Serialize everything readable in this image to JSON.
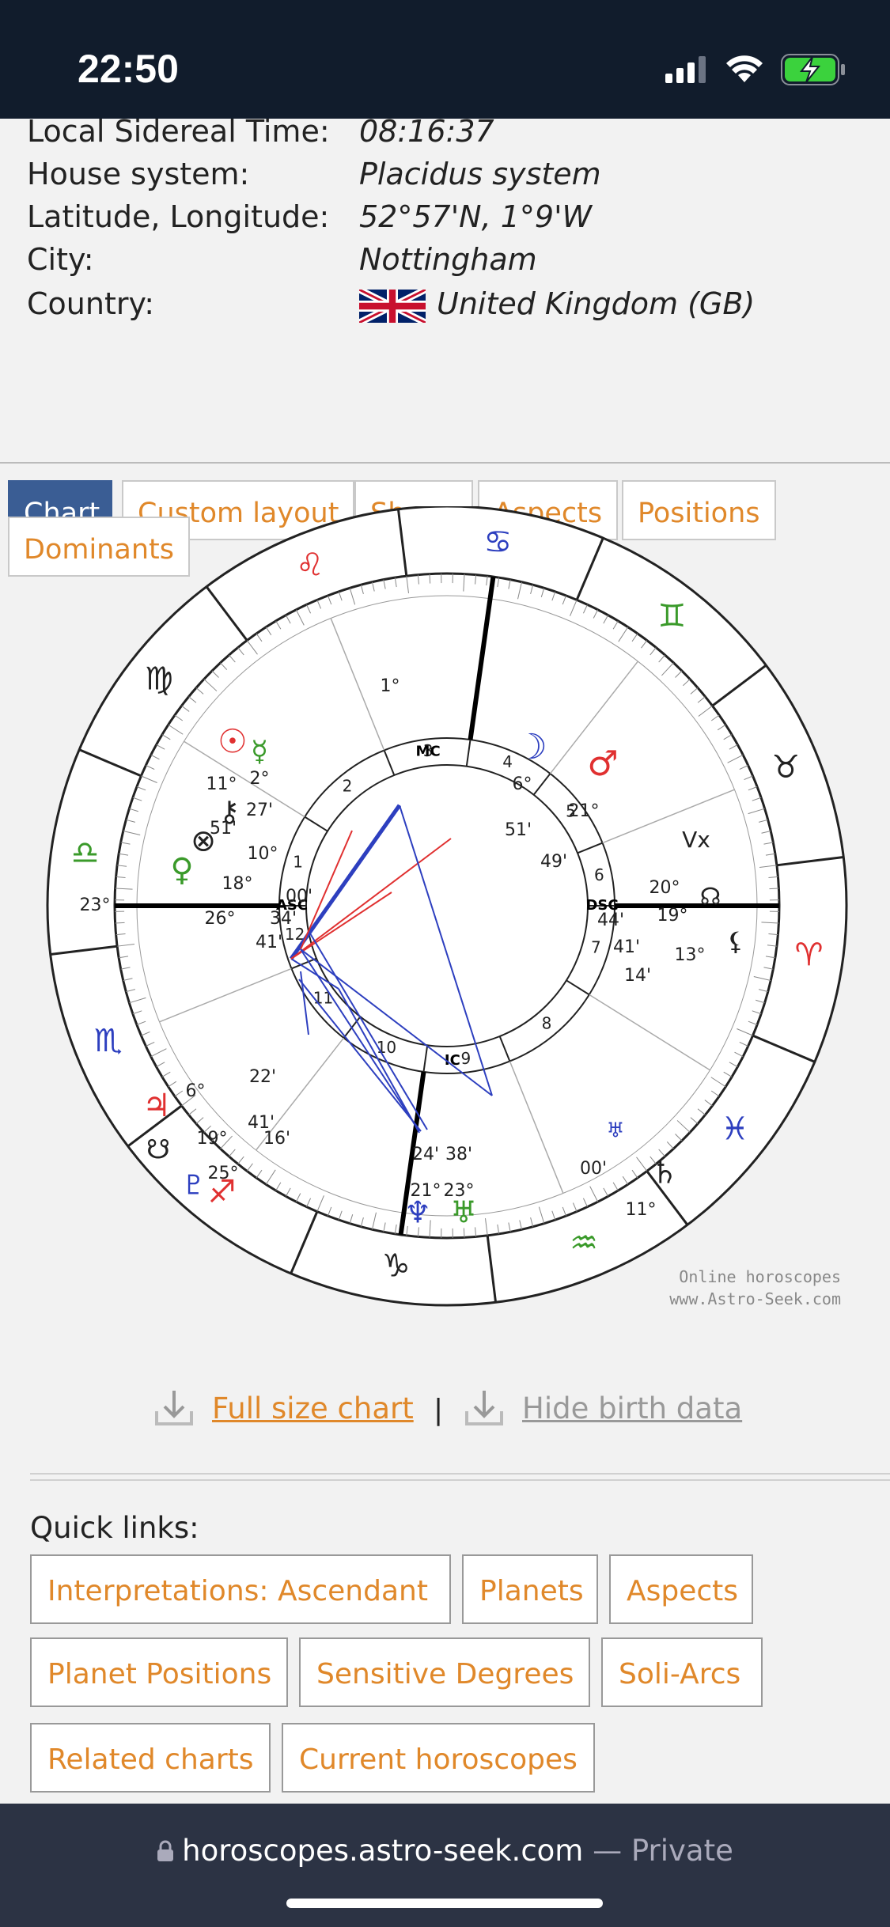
{
  "status": {
    "time": "22:50"
  },
  "info": [
    {
      "label": "Local Sidereal Time:",
      "value": "08:16:37"
    },
    {
      "label": "House system:",
      "value": "Placidus system"
    },
    {
      "label": "Latitude, Longitude:",
      "value": "52°57'N, 1°9'W"
    },
    {
      "label": "City:",
      "value": "Nottingham"
    },
    {
      "label": "Country:",
      "value": "United Kingdom (GB)"
    }
  ],
  "tabs": [
    "Chart",
    "Custom layout",
    "Shape",
    "Aspects",
    "Positions",
    "Dominants"
  ],
  "chart": {
    "house_numbers": [
      "1",
      "2",
      "3",
      "4",
      "5",
      "6",
      "7",
      "8",
      "9",
      "10",
      "11",
      "12"
    ],
    "angles": {
      "asc": "ASC",
      "dsc": "DSC",
      "mc": "MC",
      "ic": "IC"
    },
    "degree_labels": [
      "1°",
      "23°",
      "2°",
      "27'",
      "11°",
      "51'",
      "6°",
      "51'",
      "21°",
      "49'",
      "10°",
      "18°",
      "26°",
      "00'",
      "34'",
      "41'",
      "20°",
      "44'",
      "19°",
      "41'",
      "13°",
      "14'",
      "6°",
      "22'",
      "19°",
      "41'",
      "25°",
      "16'",
      "00'",
      "11°",
      "24'",
      "38'",
      "21°",
      "23°"
    ],
    "credit_line1": "Online horoscopes",
    "credit_line2": "www.Astro-Seek.com"
  },
  "downloads": {
    "full_size": "Full size chart",
    "separator": "|",
    "hide": "Hide birth data"
  },
  "quick_links": {
    "title": "Quick links:",
    "items": [
      "Interpretations: Ascendant",
      "Planets",
      "Aspects",
      "Planet Positions",
      "Sensitive Degrees",
      "Soli-Arcs",
      "Related charts",
      "Current horoscopes"
    ]
  },
  "browser": {
    "domain": "horoscopes.astro-seek.com",
    "suffix": " — Private"
  },
  "colors": {
    "accent": "#e0882a",
    "active_tab": "#3a5d94",
    "statusbar": "#111c2c",
    "bottombar": "#2c3344"
  }
}
